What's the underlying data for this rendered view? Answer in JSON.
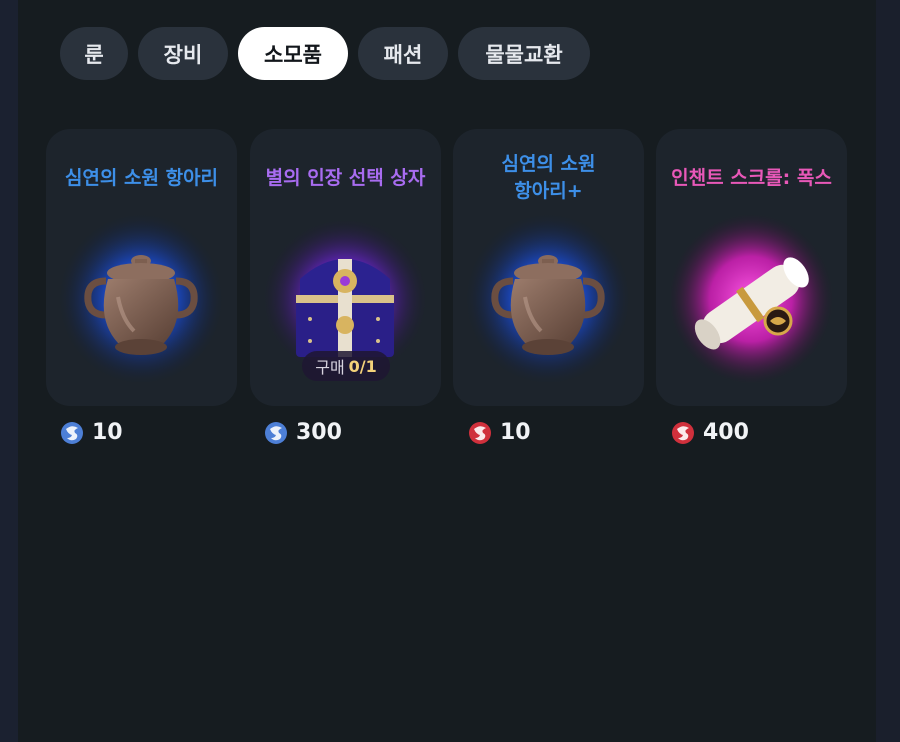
{
  "tabs": [
    {
      "label": "룬",
      "active": false
    },
    {
      "label": "장비",
      "active": false
    },
    {
      "label": "소모품",
      "active": true
    },
    {
      "label": "패션",
      "active": false
    },
    {
      "label": "물물교환",
      "active": false
    }
  ],
  "items": [
    {
      "title": "심연의 소원 항아리",
      "title_color": "#3d8fe8",
      "image": "pot-icon",
      "glow": "#1e5fff",
      "price": "10",
      "currency_icon": "blue-dragon-token-icon"
    },
    {
      "title": "별의 인장 선택 상자",
      "title_color": "#a86cf0",
      "image": "treasure-chest-icon",
      "glow": "#8a3cff",
      "purchase_label": "구매",
      "purchase_count": "0/1",
      "price": "300",
      "currency_icon": "blue-dragon-token-icon"
    },
    {
      "title_line1": "심연의 소원",
      "title_line2": "항아리+",
      "title_color": "#3d8fe8",
      "image": "pot-icon",
      "glow": "#1e5fff",
      "price": "10",
      "currency_icon": "red-dragon-token-icon"
    },
    {
      "title": "인챈트 스크롤: 폭스",
      "title_color": "#e858b8",
      "image": "scroll-icon",
      "glow": "#ff2bd0",
      "price": "400",
      "currency_icon": "red-dragon-token-icon"
    }
  ],
  "colors": {
    "blue_token": "#4d7fd6",
    "red_token": "#d0303c",
    "background": "#161c20",
    "card": "#1d242c"
  }
}
